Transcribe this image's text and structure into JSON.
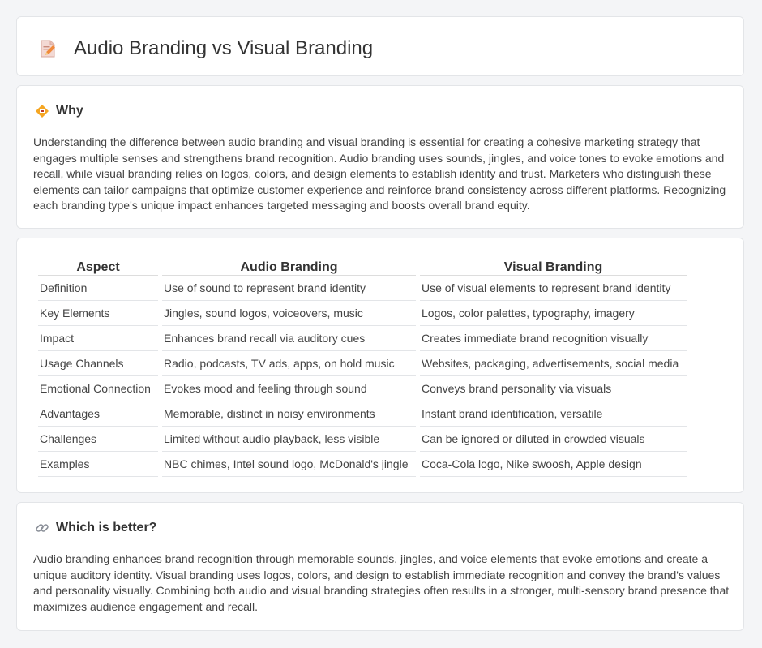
{
  "header": {
    "title": "Audio Branding vs Visual Branding",
    "icon": "document-pencil-icon"
  },
  "why": {
    "title": "Why",
    "icon": "diamond-sign-icon",
    "text": "Understanding the difference between audio branding and visual branding is essential for creating a cohesive marketing strategy that engages multiple senses and strengthens brand recognition. Audio branding uses sounds, jingles, and voice tones to evoke emotions and recall, while visual branding relies on logos, colors, and design elements to establish identity and trust. Marketers who distinguish these elements can tailor campaigns that optimize customer experience and reinforce brand consistency across different platforms. Recognizing each branding type's unique impact enhances targeted messaging and boosts overall brand equity."
  },
  "table": {
    "headers": [
      "Aspect",
      "Audio Branding",
      "Visual Branding"
    ],
    "rows": [
      [
        "Definition",
        "Use of sound to represent brand identity",
        "Use of visual elements to represent brand identity"
      ],
      [
        "Key Elements",
        "Jingles, sound logos, voiceovers, music",
        "Logos, color palettes, typography, imagery"
      ],
      [
        "Impact",
        "Enhances brand recall via auditory cues",
        "Creates immediate brand recognition visually"
      ],
      [
        "Usage Channels",
        "Radio, podcasts, TV ads, apps, on hold music",
        "Websites, packaging, advertisements, social media"
      ],
      [
        "Emotional Connection",
        "Evokes mood and feeling through sound",
        "Conveys brand personality via visuals"
      ],
      [
        "Advantages",
        "Memorable, distinct in noisy environments",
        "Instant brand identification, versatile"
      ],
      [
        "Challenges",
        "Limited without audio playback, less visible",
        "Can be ignored or diluted in crowded visuals"
      ],
      [
        "Examples",
        "NBC chimes, Intel sound logo, McDonald's jingle",
        "Coca-Cola logo, Nike swoosh, Apple design"
      ]
    ]
  },
  "better": {
    "title": "Which is better?",
    "icon": "link-icon",
    "text": "Audio branding enhances brand recognition through memorable sounds, jingles, and voice elements that evoke emotions and create a unique auditory identity. Visual branding uses logos, colors, and design to establish immediate recognition and convey the brand's values and personality visually. Combining both audio and visual branding strategies often results in a stronger, multi-sensory brand presence that maximizes audience engagement and recall."
  }
}
